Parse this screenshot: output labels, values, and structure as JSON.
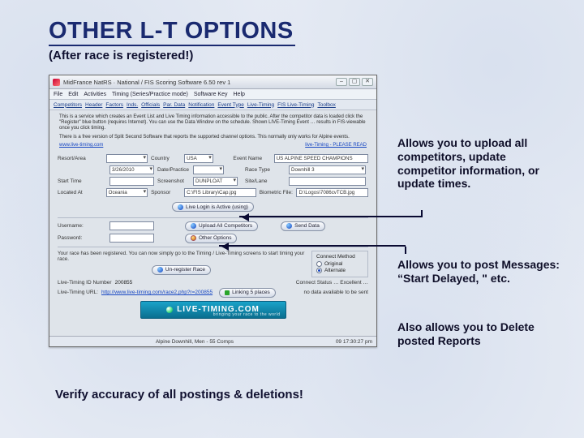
{
  "title": "OTHER L-T OPTIONS",
  "subtitle": "(After race is registered!)",
  "annot": {
    "a1": "Allows you to upload all competitors, update competitor information, or update times.",
    "a2": "Allows you to post Messages:\n“Start Delayed, \" etc.",
    "a3": "Also allows you to Delete posted Reports"
  },
  "footer": "Verify accuracy of all postings & deletions!",
  "window": {
    "title": "MidFrance NatRS · National / FIS Scoring Software 6.50 rev 1",
    "controls": {
      "min": "–",
      "max": "▢",
      "close": "✕"
    },
    "menubar": [
      "File",
      "Edit",
      "Activities",
      "Timing (Series/Practice mode)",
      "Software Key",
      "Help"
    ],
    "toolbar": [
      "Competitors",
      "Header",
      "Factors",
      "Inds.",
      "Officials",
      "Par. Data",
      "Notification",
      "Event Type",
      "Live-Timing",
      "FIS Live-Timing",
      "Toolbox"
    ],
    "intro1": "This is a service which creates an Event List and Live Timing information accessible to the public. After the competitor data is loaded click the \"Register\" blue button (requires Internet). You can use the Data Window on the schedule. Shown LIVE-Timing Event … results in FIS-viewable once you click timing.",
    "intro2": "There is a free version of Split Second Software that reports the supported channel options. This normally only works for Alpine events.",
    "intro_link_a": "www.live-timing.com",
    "intro_link_b": "live-Timing - PLEASE READ",
    "fields": {
      "resort_l": "Resort/Area",
      "resort_v": "",
      "country_l": "Country",
      "country_v": "USA",
      "event_l": "Event Name",
      "event_v": "US ALPINE SPEED CHAMPIONS",
      "date_l": "",
      "date_v": "3/26/2010",
      "period_l": "Date/Practice",
      "period_v": "",
      "rtype_l": "Race Type",
      "rtype_v": "Downhill 3",
      "start_l": "Start Time",
      "start_v": "",
      "sponsor_l": "Screenshot",
      "sponsor_v": "DUNPLOAT",
      "station_l": "Site/Lane",
      "station_v": "",
      "loc_l": "Located At",
      "loc_v": "Oceania",
      "spf_l": "Sponsor",
      "spf_v": "C:\\FIS Library\\Cap.jpg",
      "biof_l": "Biometric File:",
      "biof_v": "D:\\Logos\\7086cvTCB.jpg",
      "login_l": "Username:",
      "login_v": "",
      "pass_l": "Password:",
      "pass_v": ""
    },
    "btn_login": "Live Login is Active (using)",
    "btn_upload": "Upload All Competitors",
    "btn_send": "Send Data",
    "btn_other": "Other Options",
    "block_text": "Your race has been registered. You can now simply go to the Timing / Live-Timing screens to start timing your race.",
    "radio_title": "Connect Method",
    "radio_a": "Original",
    "radio_b": "Alternate",
    "btn_unreg": "Un-register Race",
    "reg_line_l": "Live-Timing ID Number",
    "reg_line_v": "200855",
    "link_line_l": "Live-Timing URL:",
    "link_line_v": "http://www.live-timing.com/race2.php?r=200855",
    "progress": "Linking 5 places",
    "conn": "Connect Status … Excellent …",
    "conn2": "no data available to be sent",
    "banner": "LIVE-TIMING.COM",
    "banner_sub": "bringing your race to the world",
    "status_l": "Alpine Downhill, Men - 55 Comps",
    "status_r": "09  17:30:27 pm"
  }
}
